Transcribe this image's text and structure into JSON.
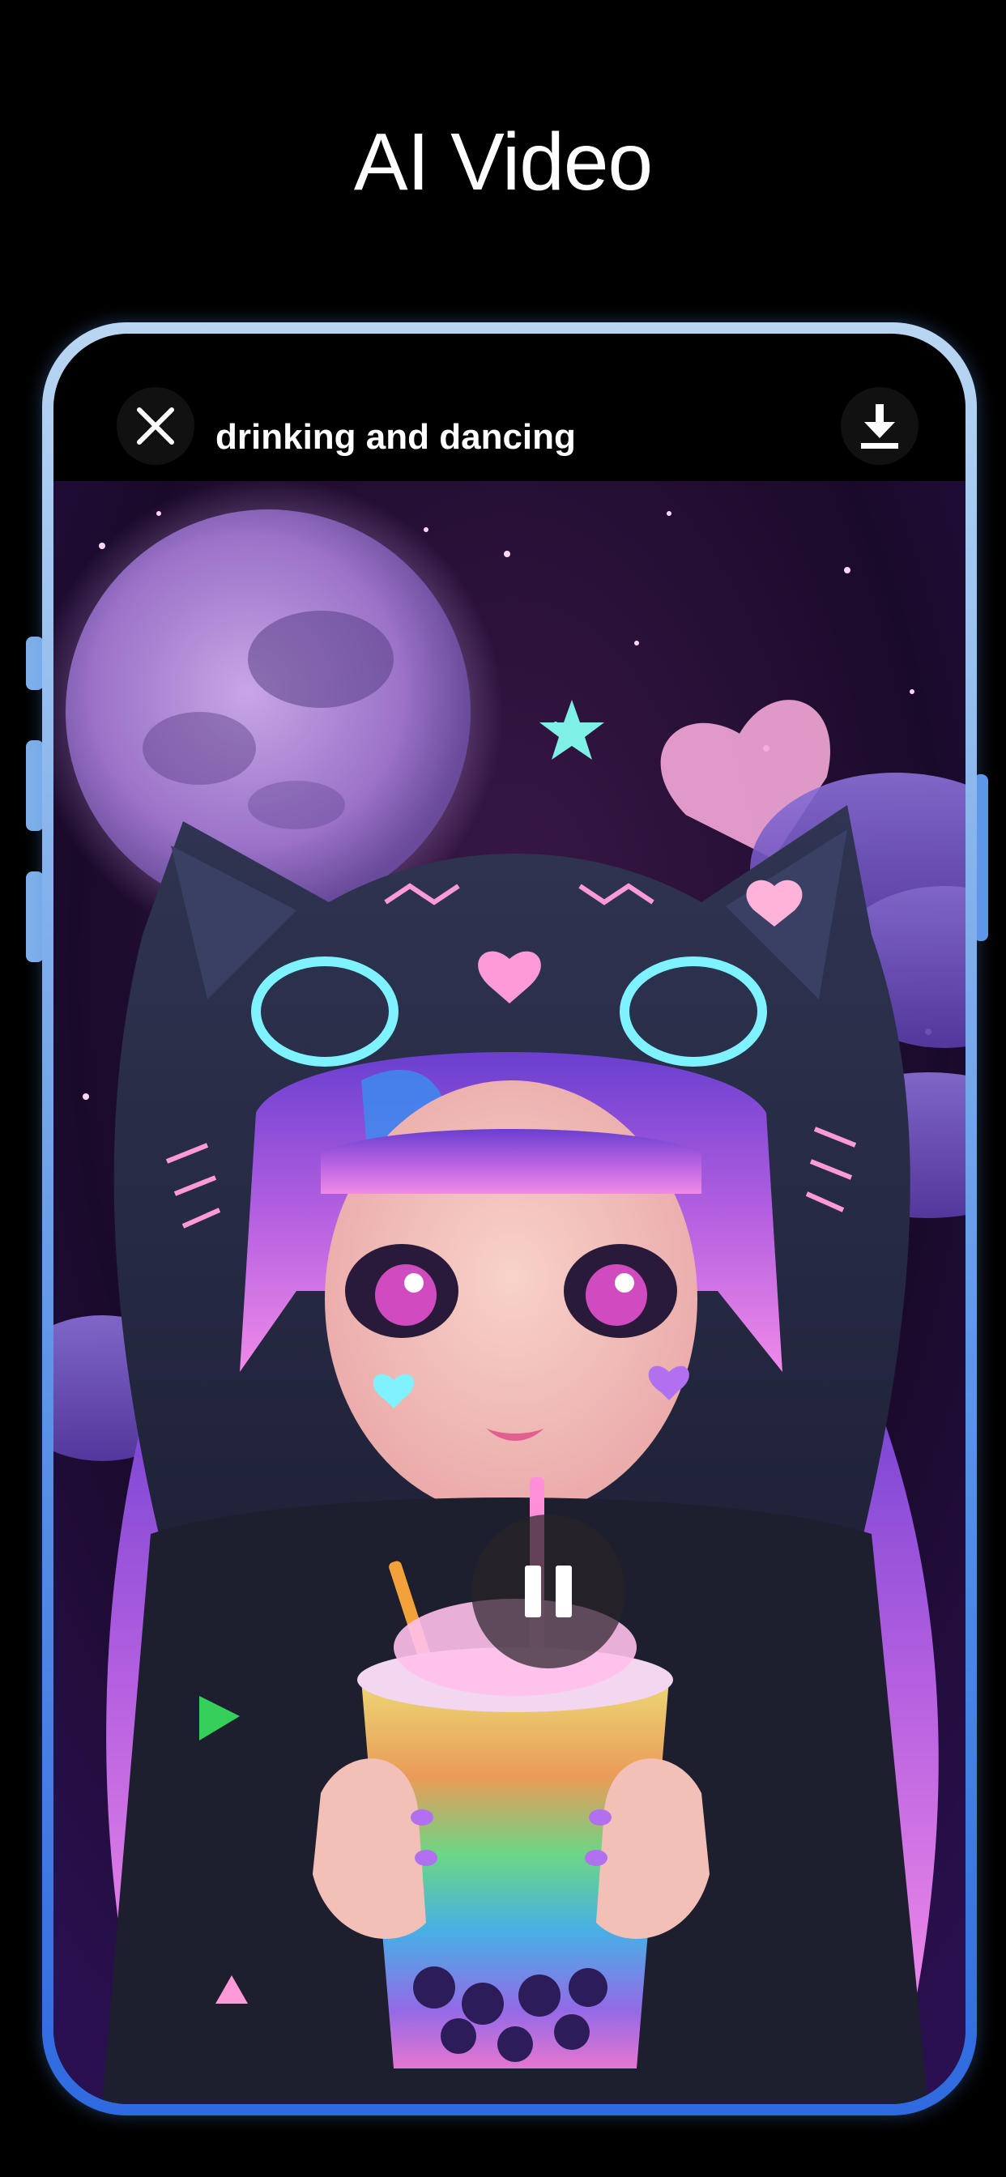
{
  "headline": "AI Video",
  "player": {
    "title": "drinking and dancing",
    "close_icon": "close-icon",
    "download_icon": "download-icon",
    "pause_icon": "pause-icon",
    "state": "playing"
  },
  "colors": {
    "background": "#000000",
    "frame_top": "#b9d6f2",
    "frame_bottom": "#2f6ae0",
    "text": "#ffffff"
  }
}
